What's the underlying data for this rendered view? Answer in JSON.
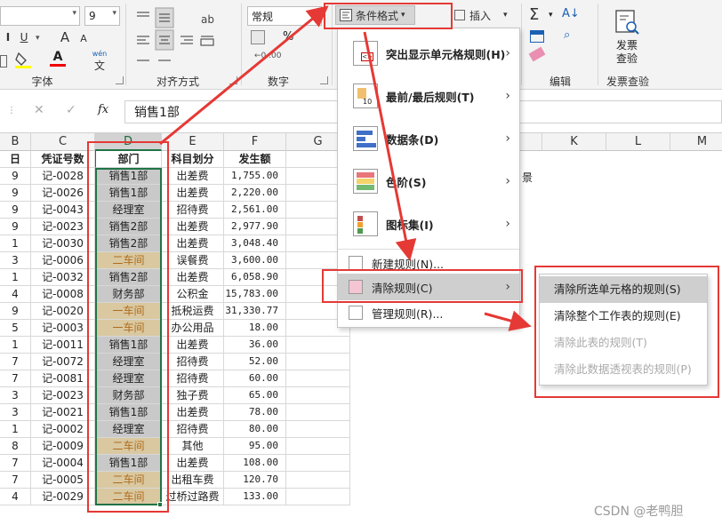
{
  "ribbon": {
    "font_size": "9",
    "number_format": "常规",
    "cond_format_label": "条件格式",
    "insert_label": "插入",
    "invoice_check_label": "发票查验",
    "groups": {
      "font": "字体",
      "alignment": "对齐方式",
      "number": "数字",
      "editing": "编辑",
      "invoice": "发票查验"
    },
    "font_buttons": {
      "underline": "U",
      "grow": "A",
      "shrink": "A",
      "phonetic": "wén",
      "font_color": "A"
    },
    "number_buttons": {
      "percent": "%",
      "comma": ",",
      "sum": "Σ"
    }
  },
  "formula_bar": {
    "cancel": "✕",
    "confirm": "✓",
    "fx": "fx",
    "value": "销售1部"
  },
  "columns": [
    "B",
    "C",
    "D",
    "E",
    "F",
    "G",
    "",
    "",
    "",
    "K",
    "L",
    "M"
  ],
  "table": {
    "headers": [
      "凭证号数",
      "部门",
      "科目划分",
      "发生额"
    ],
    "row_prefixes": [
      "9",
      "9",
      "9",
      "9",
      "1",
      "3",
      "1",
      "4",
      "9",
      "5",
      "1",
      "7",
      "7",
      "3",
      "3",
      "1",
      "8",
      "7",
      "7",
      "4"
    ],
    "rows": [
      [
        "记-0028",
        "销售1部",
        "出差费",
        "1,755.00",
        "grey"
      ],
      [
        "记-0026",
        "销售1部",
        "出差费",
        "2,220.00",
        "grey"
      ],
      [
        "记-0043",
        "经理室",
        "招待费",
        "2,561.00",
        "grey"
      ],
      [
        "记-0023",
        "销售2部",
        "出差费",
        "2,977.90",
        "grey"
      ],
      [
        "记-0030",
        "销售2部",
        "出差费",
        "3,048.40",
        "grey"
      ],
      [
        "记-0006",
        "二车间",
        "误餐费",
        "3,600.00",
        "tan"
      ],
      [
        "记-0032",
        "销售2部",
        "出差费",
        "6,058.90",
        "grey"
      ],
      [
        "记-0008",
        "财务部",
        "公积金",
        "15,783.00",
        "grey"
      ],
      [
        "记-0020",
        "一车间",
        "抵税运费",
        "31,330.77",
        "tan"
      ],
      [
        "记-0003",
        "一车间",
        "办公用品",
        "18.00",
        "tan"
      ],
      [
        "记-0011",
        "销售1部",
        "出差费",
        "36.00",
        "grey"
      ],
      [
        "记-0072",
        "经理室",
        "招待费",
        "52.00",
        "grey"
      ],
      [
        "记-0081",
        "经理室",
        "招待费",
        "60.00",
        "grey"
      ],
      [
        "记-0023",
        "财务部",
        "独子费",
        "65.00",
        "grey"
      ],
      [
        "记-0021",
        "销售1部",
        "出差费",
        "78.00",
        "grey"
      ],
      [
        "记-0002",
        "经理室",
        "招待费",
        "80.00",
        "grey"
      ],
      [
        "记-0009",
        "二车间",
        "其他",
        "95.00",
        "tan"
      ],
      [
        "记-0004",
        "销售1部",
        "出差费",
        "108.00",
        "grey"
      ],
      [
        "记-0005",
        "二车间",
        "出租车费",
        "120.70",
        "tan"
      ],
      [
        "记-0029",
        "二车间",
        "过桥过路费",
        "133.00",
        "tan"
      ]
    ],
    "stray_text": "景"
  },
  "cf_menu": {
    "items": [
      {
        "label": "突出显示单元格规则(H)",
        "has_sub": true
      },
      {
        "label": "最前/最后规则(T)",
        "has_sub": true
      },
      {
        "label": "数据条(D)",
        "has_sub": true
      },
      {
        "label": "色阶(S)",
        "has_sub": true
      },
      {
        "label": "图标集(I)",
        "has_sub": true
      }
    ],
    "new_rule": "新建规则(N)...",
    "clear_rules": "清除规则(C)",
    "manage_rules": "管理规则(R)..."
  },
  "clear_submenu": {
    "items": [
      {
        "label": "清除所选单元格的规则(S)",
        "state": "highlighted"
      },
      {
        "label": "清除整个工作表的规则(E)",
        "state": "enabled"
      },
      {
        "label": "清除此表的规则(T)",
        "state": "disabled"
      },
      {
        "label": "清除此数据透视表的规则(P)",
        "state": "disabled"
      }
    ]
  },
  "colors": {
    "annotation_red": "#e53935",
    "excel_green": "#217346",
    "grey_fill": "#c9c9c9",
    "tan_fill": "#d9c8a0"
  },
  "watermark": "CSDN @老鸭胆"
}
